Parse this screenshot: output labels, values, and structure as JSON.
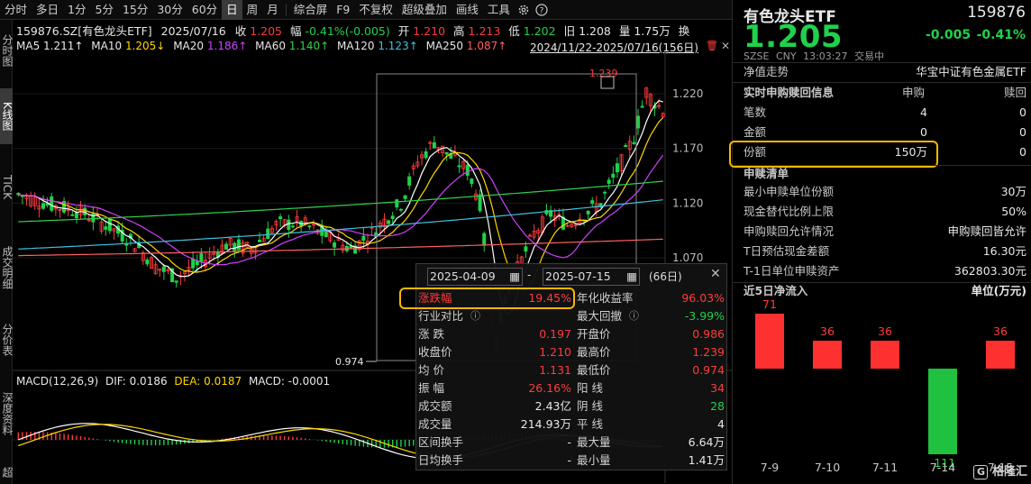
{
  "toolbar": {
    "periods": [
      "分时",
      "多日",
      "1分",
      "5分",
      "15分",
      "30分",
      "60分",
      "日",
      "周",
      "月"
    ],
    "active_period": "日",
    "tools": [
      "综合屏",
      "F9",
      "不复权",
      "超级叠加",
      "画线",
      "工具"
    ]
  },
  "left_tabs": [
    "分时图",
    "K线图",
    "TICK",
    "成交明细",
    "分价表",
    "深度资料",
    "超"
  ],
  "stock_line": {
    "code_name": "159876.SZ[有色龙头ETF]",
    "date": "2025/07/16",
    "close_label": "收",
    "close": "1.205",
    "change_label": "幅",
    "change": "-0.41%(-0.005)",
    "open_label": "开",
    "open": "1.210",
    "high_label": "高",
    "high": "1.213",
    "low_label": "低",
    "low": "1.202",
    "prev_label": "旧",
    "prev": "1.208",
    "vol_label": "量",
    "vol": "1.75万",
    "swap": "换"
  },
  "ma_line": {
    "ma5_label": "MA5",
    "ma5": "1.211↑",
    "ma10_label": "MA10",
    "ma10": "1.205↓",
    "ma20_label": "MA20",
    "ma20": "1.186↑",
    "ma60_label": "MA60",
    "ma60": "1.140↑",
    "ma120_label": "MA120",
    "ma120": "1.123↑",
    "ma250_label": "MA250",
    "ma250": "1.087↑",
    "range": "2024/11/22-2025/07/16(156日)"
  },
  "price_axis": [
    "1.220",
    "1.170",
    "1.120",
    "1.070"
  ],
  "markers": {
    "max": "1.239",
    "min": "0.974"
  },
  "macd": {
    "title": "MACD(12,26,9)",
    "dif_label": "DIF:",
    "dif": "0.0186",
    "dea_label": "DEA:",
    "dea": "0.0187",
    "macd_label": "MACD:",
    "macd": "-0.0001"
  },
  "colors": {
    "up": "#ff3b3b",
    "down": "#1fd24a",
    "ma5": "#ffffff",
    "ma10": "#ffd700",
    "ma20": "#d040ff",
    "ma60": "#2fd24a",
    "ma120": "#40c0e0",
    "ma250": "#ff6060",
    "highlight": "#f5b800"
  },
  "popup": {
    "date_from": "2025-04-09",
    "date_sep": "-",
    "date_to": "2025-07-15",
    "days": "(66日)",
    "left_rows": [
      {
        "label": "涨跌幅",
        "value": "19.45%",
        "color": "red"
      },
      {
        "label": "行业对比",
        "value": "",
        "color": "white"
      },
      {
        "label": "涨    跌",
        "value": "0.197",
        "color": "red"
      },
      {
        "label": "收盘价",
        "value": "1.210",
        "color": "red"
      },
      {
        "label": "均    价",
        "value": "1.131",
        "color": "red"
      },
      {
        "label": "振    幅",
        "value": "26.16%",
        "color": "red"
      },
      {
        "label": "成交额",
        "value": "2.43亿",
        "color": "white"
      },
      {
        "label": "成交量",
        "value": "214.93万",
        "color": "white"
      },
      {
        "label": "区间换手",
        "value": "-",
        "color": "white"
      },
      {
        "label": "日均换手",
        "value": "-",
        "color": "white"
      }
    ],
    "right_rows": [
      {
        "label": "年化收益率",
        "value": "96.03%",
        "color": "red"
      },
      {
        "label": "最大回撤",
        "value": "-3.99%",
        "color": "green"
      },
      {
        "label": "开盘价",
        "value": "0.986",
        "color": "red"
      },
      {
        "label": "最高价",
        "value": "1.239",
        "color": "red"
      },
      {
        "label": "最低价",
        "value": "0.974",
        "color": "red"
      },
      {
        "label": "阳    线",
        "value": "34",
        "color": "red"
      },
      {
        "label": "阴    线",
        "value": "28",
        "color": "green"
      },
      {
        "label": "平    线",
        "value": "4",
        "color": "white"
      },
      {
        "label": "最大量",
        "value": "6.64万",
        "color": "white"
      },
      {
        "label": "最小量",
        "value": "1.41万",
        "color": "white"
      }
    ]
  },
  "right_panel": {
    "name": "有色龙头ETF",
    "code": "159876",
    "price": "1.205",
    "change": "-0.005",
    "change_pct": "-0.41%",
    "market": "SZSE",
    "currency": "CNY",
    "time": "13:03:27",
    "status": "交易中",
    "nav_label": "净值走势",
    "fund_full_name": "华宝中证有色金属ETF",
    "subscribe_header": "实时申购赎回信息",
    "subscribe_col": "申购",
    "redeem_col": "赎回",
    "sub_rows": [
      {
        "label": "笔数",
        "sub": "4",
        "red": "0"
      },
      {
        "label": "金额",
        "sub": "0",
        "red": "0"
      },
      {
        "label": "份额",
        "sub": "150万",
        "red": "0"
      }
    ],
    "list_header": "申赎清单",
    "list_rows": [
      {
        "label": "最小申赎单位份额",
        "value": "30万"
      },
      {
        "label": "现金替代比例上限",
        "value": "50%"
      },
      {
        "label": "申购赎回允许情况",
        "value": "申购赎回皆允许"
      },
      {
        "label": "T日预估现金差额",
        "value": "16.30元"
      },
      {
        "label": "T-1日单位申赎资产",
        "value": "362803.30元"
      }
    ],
    "flow_header": "近5日净流入",
    "flow_unit": "单位(万元)",
    "flows": [
      {
        "date": "7-9",
        "value": 71
      },
      {
        "date": "7-10",
        "value": 36
      },
      {
        "date": "7-11",
        "value": 36
      },
      {
        "date": "7-14",
        "value": -111
      },
      {
        "date": "7-15",
        "value": 36
      }
    ],
    "watermark": "格隆汇"
  }
}
